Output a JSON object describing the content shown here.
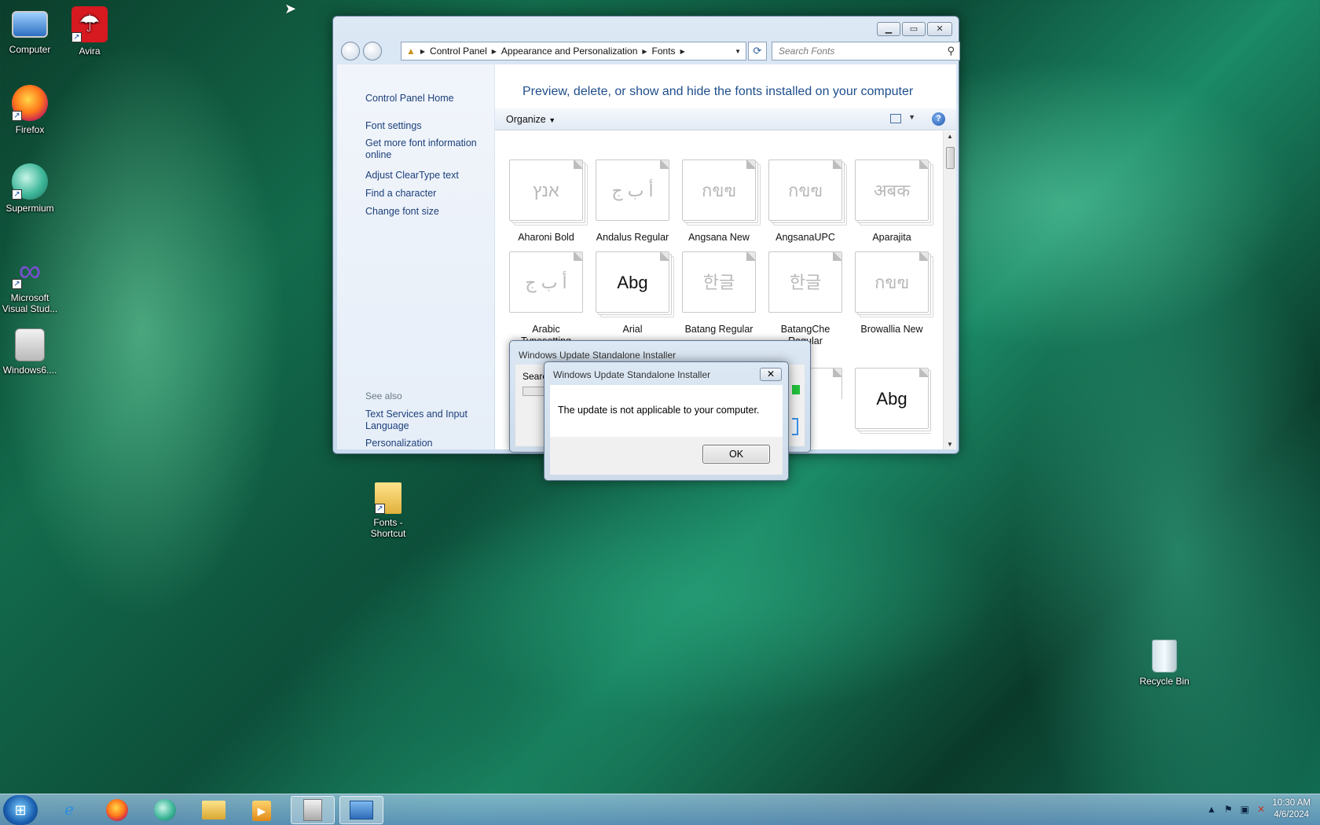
{
  "desktop_icons": [
    {
      "name": "computer",
      "label": "Computer",
      "glyph": "🖥"
    },
    {
      "name": "avira",
      "label": "Avira",
      "glyph": "☂"
    },
    {
      "name": "firefox",
      "label": "Firefox",
      "glyph": "🦊"
    },
    {
      "name": "supermium",
      "label": "Supermium",
      "glyph": "◉"
    },
    {
      "name": "visual-studio",
      "label": "Microsoft Visual Stud...",
      "glyph": "∞"
    },
    {
      "name": "windows6",
      "label": "Windows6....",
      "glyph": "▤"
    },
    {
      "name": "fonts-shortcut",
      "label": "Fonts - Shortcut",
      "glyph": "📁"
    },
    {
      "name": "recycle-bin",
      "label": "Recycle Bin",
      "glyph": "🗑"
    }
  ],
  "explorer": {
    "breadcrumb": [
      "Control Panel",
      "Appearance and Personalization",
      "Fonts"
    ],
    "search_placeholder": "Search Fonts",
    "left_links": [
      "Control Panel Home",
      "Font settings",
      "Get more font information online",
      "Adjust ClearType text",
      "Find a character",
      "Change font size"
    ],
    "see_also_label": "See also",
    "see_also_links": [
      "Text Services and Input Language",
      "Personalization"
    ],
    "heading": "Preview, delete, or show and hide the fonts installed on your computer",
    "organize_label": "Organize",
    "help_glyph": "?",
    "fonts": [
      {
        "name": "Aharoni Bold",
        "preview": "אנץ"
      },
      {
        "name": "Andalus Regular",
        "preview": "أ ب ج"
      },
      {
        "name": "Angsana New",
        "preview": "กขฃ"
      },
      {
        "name": "AngsanaUPC",
        "preview": "กขฃ"
      },
      {
        "name": "Aparajita",
        "preview": "अबक"
      },
      {
        "name": "Arabic Typesetting Regular",
        "preview": "أ ب ج"
      },
      {
        "name": "Arial",
        "preview": "Abg"
      },
      {
        "name": "Batang Regular",
        "preview": "한글"
      },
      {
        "name": "BatangChe Regular",
        "preview": "한글"
      },
      {
        "name": "Browallia New",
        "preview": "กขฃ"
      },
      {
        "name": "",
        "preview": "ě"
      },
      {
        "name": "",
        "preview": "Abg"
      }
    ]
  },
  "installer_window": {
    "title": "Windows Update Standalone Installer",
    "partial_text": "Searc"
  },
  "dialog": {
    "title": "Windows Update Standalone Installer",
    "message": "The update is not applicable to your computer.",
    "ok_label": "OK",
    "close_glyph": "✕"
  },
  "taskbar": {
    "apps": [
      "internet-explorer",
      "firefox",
      "supermium",
      "file-explorer",
      "media-player",
      "windows-update-installer",
      "control-panel"
    ],
    "time": "10:30 AM",
    "date": "4/6/2024"
  }
}
